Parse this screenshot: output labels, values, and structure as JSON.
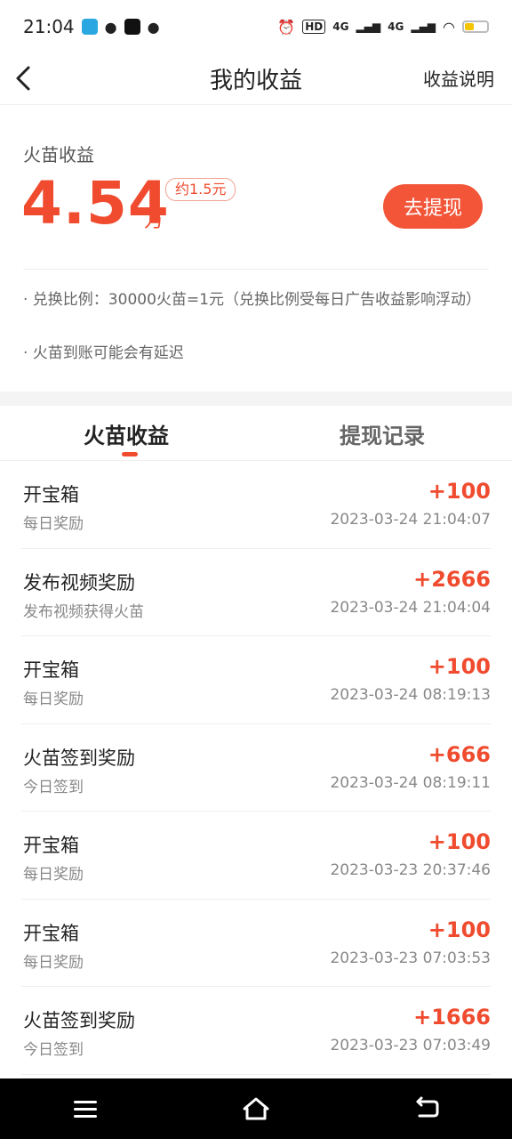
{
  "status": {
    "time": "21:04",
    "network_1": "4G",
    "network_2": "4G",
    "hd_label": "HD",
    "battery_color": "#f5c400"
  },
  "nav": {
    "title": "我的收益",
    "right_link": "收益说明"
  },
  "earnings": {
    "label": "火苗收益",
    "amount": "4.54",
    "unit": "万",
    "approx": "约1.5元",
    "withdraw_label": "去提现",
    "note_1": "· 兑换比例：30000火苗=1元（兑换比例受每日广告收益影响浮动）",
    "note_2": "· 火苗到账可能会有延迟",
    "accent_color": "#f04b2f"
  },
  "tabs": [
    {
      "label": "火苗收益",
      "active": true
    },
    {
      "label": "提现记录",
      "active": false
    }
  ],
  "records": [
    {
      "title": "开宝箱",
      "sub": "每日奖励",
      "amount": "+100",
      "time": "2023-03-24 21:04:07"
    },
    {
      "title": "发布视频奖励",
      "sub": "发布视频获得火苗",
      "amount": "+2666",
      "time": "2023-03-24 21:04:04"
    },
    {
      "title": "开宝箱",
      "sub": "每日奖励",
      "amount": "+100",
      "time": "2023-03-24 08:19:13"
    },
    {
      "title": "火苗签到奖励",
      "sub": "今日签到",
      "amount": "+666",
      "time": "2023-03-24 08:19:11"
    },
    {
      "title": "开宝箱",
      "sub": "每日奖励",
      "amount": "+100",
      "time": "2023-03-23 20:37:46"
    },
    {
      "title": "开宝箱",
      "sub": "每日奖励",
      "amount": "+100",
      "time": "2023-03-23 07:03:53"
    },
    {
      "title": "火苗签到奖励",
      "sub": "今日签到",
      "amount": "+1666",
      "time": "2023-03-23 07:03:49"
    }
  ],
  "icons": {
    "back": "chevron-left-icon",
    "menu": "menu-icon",
    "home": "home-icon",
    "return": "return-icon"
  }
}
